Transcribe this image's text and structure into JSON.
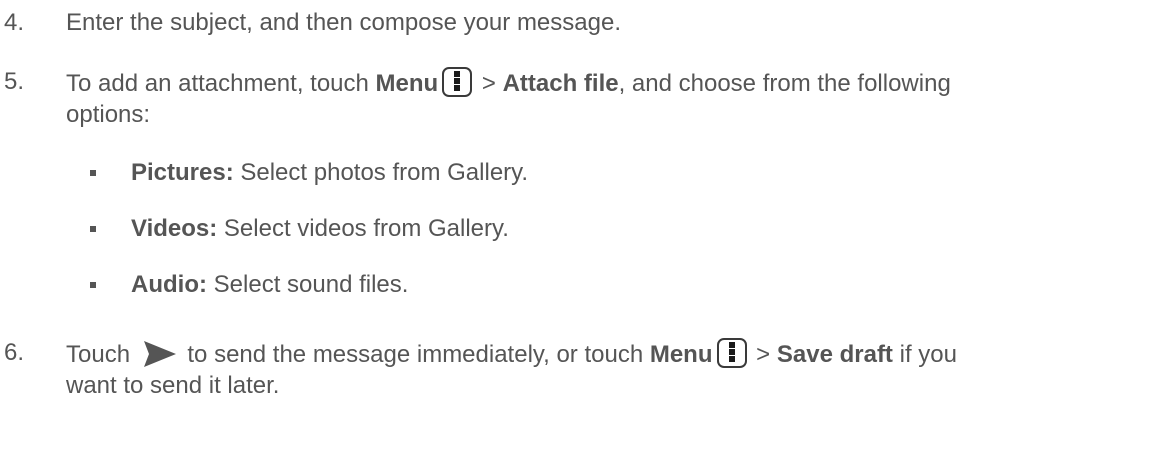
{
  "steps": [
    {
      "number": "4.",
      "text": "Enter the subject, and then compose your message."
    },
    {
      "number": "5.",
      "line1_pre": "To add an attachment, touch ",
      "menu_label": "Menu",
      "line1_sep": " > ",
      "attach_label": "Attach file",
      "line1_post": ", and choose from the following",
      "line2": "options:",
      "options": [
        {
          "label": "Pictures:",
          "text": " Select photos from Gallery."
        },
        {
          "label": "Videos:",
          "text": " Select videos from Gallery."
        },
        {
          "label": "Audio:",
          "text": " Select sound files."
        }
      ]
    },
    {
      "number": "6.",
      "line1_pre": "Touch ",
      "line1_mid": " to send the message immediately, or touch ",
      "menu_label": "Menu",
      "line1_sep": " > ",
      "save_label": "Save draft",
      "line1_post": " if you",
      "line2": "want to send it later."
    }
  ],
  "icons": {
    "menu": "menu-icon",
    "send": "send-icon"
  },
  "colors": {
    "text": "#555555",
    "icon_border": "#3a3a3a",
    "send_icon": "#555555"
  }
}
